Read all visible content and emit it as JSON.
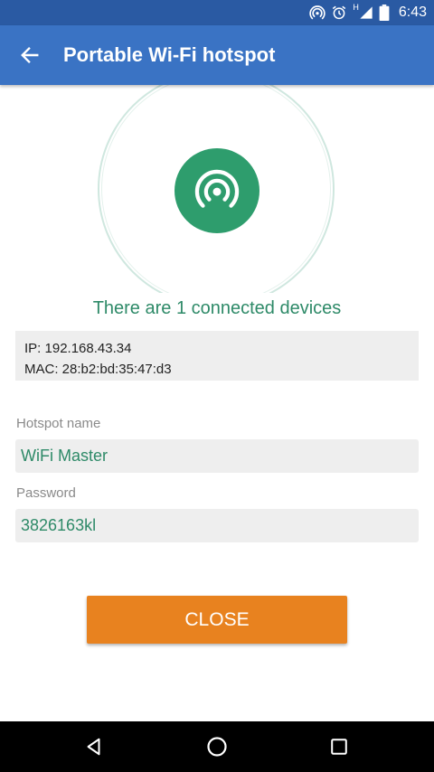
{
  "status_bar": {
    "time": "6:43",
    "icons": [
      "hotspot-icon",
      "alarm-icon",
      "signal-icon",
      "battery-icon"
    ],
    "network_type": "H"
  },
  "app_bar": {
    "title": "Portable Wi-Fi hotspot",
    "back_icon": "back-arrow-icon",
    "color": "#3a73c4"
  },
  "hotspot": {
    "icon": "hotspot-icon",
    "connected_text": "There are 1 connected devices",
    "accent_color": "#2e9d6d"
  },
  "device": {
    "ip": "IP: 192.168.43.34",
    "mac": "MAC: 28:b2:bd:35:47:d3"
  },
  "form": {
    "name_label": "Hotspot name",
    "name_value": "WiFi Master",
    "password_label": "Password",
    "password_value": "3826163kl"
  },
  "actions": {
    "close_label": "CLOSE",
    "close_color": "#e8821f"
  },
  "nav_bar": {
    "icons": [
      "back-triangle-icon",
      "home-circle-icon",
      "recents-square-icon"
    ]
  }
}
